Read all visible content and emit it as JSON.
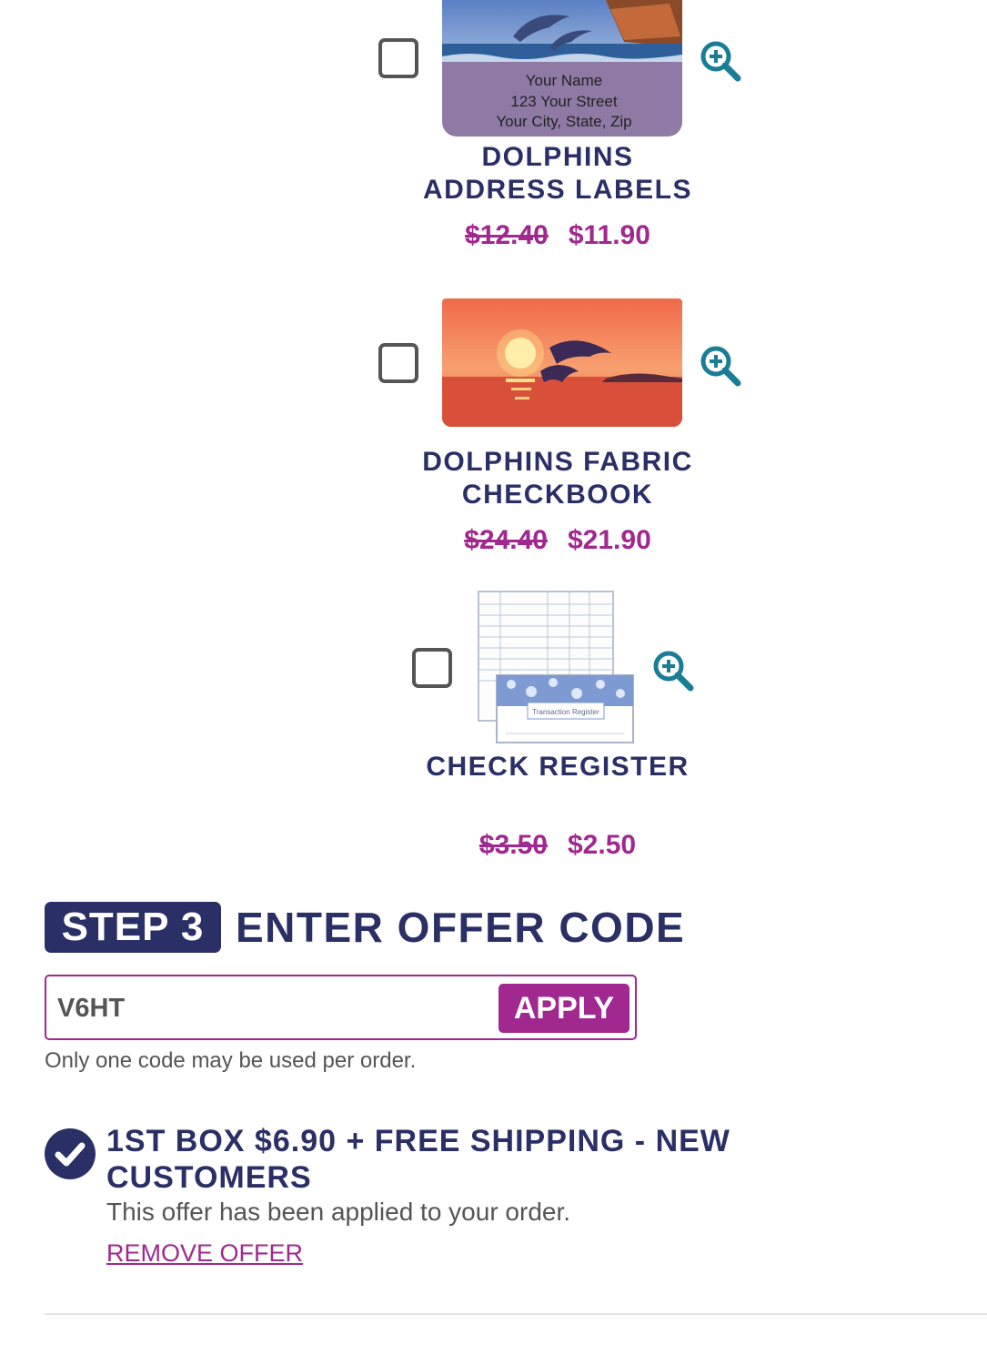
{
  "products": [
    {
      "title_line1": "DOLPHINS",
      "title_line2": "ADDRESS LABELS",
      "old_price": "$12.40",
      "new_price": "$11.90",
      "label_lines": [
        "Your Name",
        "123 Your Street",
        "Your City, State, Zip"
      ],
      "checked": false
    },
    {
      "title_line1": "DOLPHINS FABRIC",
      "title_line2": "CHECKBOOK",
      "old_price": "$24.40",
      "new_price": "$21.90",
      "checked": false
    },
    {
      "title_line1": "CHECK REGISTER",
      "old_price": "$3.50",
      "new_price": "$2.50",
      "register_cover_text": "Transaction Register",
      "checked": false
    }
  ],
  "step3": {
    "badge": "STEP 3",
    "title": "ENTER OFFER CODE",
    "code_value": "V6HT",
    "apply_label": "APPLY",
    "note": "Only one code may be used per order."
  },
  "offer": {
    "title": "1ST BOX $6.90 + FREE SHIPPING - NEW CUSTOMERS",
    "applied_text": "This offer has been applied to your order.",
    "remove_label": "REMOVE OFFER"
  },
  "colors": {
    "navy": "#2a2f66",
    "magenta": "#a0288f",
    "zoom_teal": "#1a7d96"
  },
  "icons": {
    "zoom": "zoom-in-icon",
    "check": "checkmark-icon"
  }
}
